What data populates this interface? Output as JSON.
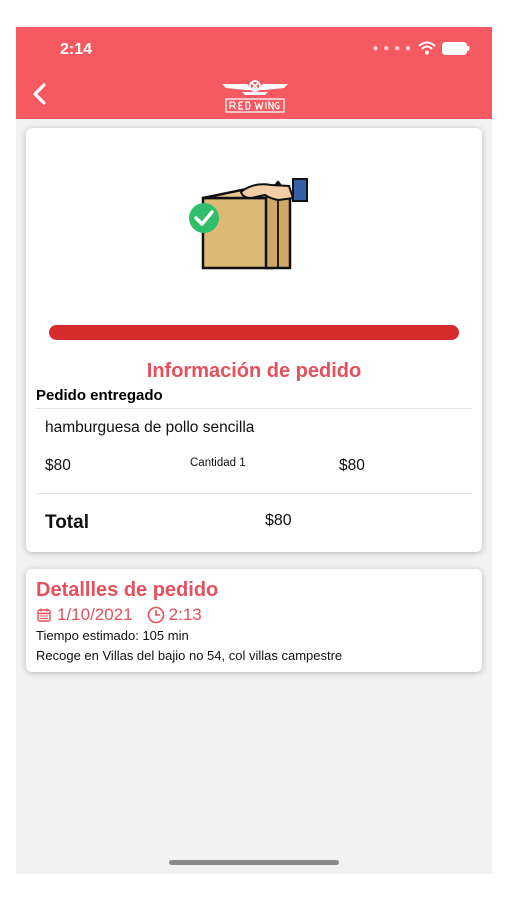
{
  "status_bar": {
    "time": "2:14"
  },
  "header": {
    "brand": "RED WINGS"
  },
  "order_info": {
    "title": "Información de pedido",
    "status": "Pedido entregado",
    "progress": 1.0,
    "item": {
      "name": "hamburguesa de pollo sencilla",
      "unit_price": "$80",
      "quantity_label": "Cantidad 1",
      "line_total": "$80"
    },
    "total_label": "Total",
    "total_value": "$80"
  },
  "order_details": {
    "title": "Detallles de pedido",
    "date": "1/10/2021",
    "time": "2:13",
    "estimated_time": "Tiempo estimado: 105 min",
    "pickup": "Recoge en Villas del bajio no 54, col villas campestre"
  },
  "colors": {
    "header": "#f55a63",
    "accent": "#e4505c",
    "progress": "#d62b2b",
    "check": "#2fbf6a",
    "bag": "#ddb976"
  }
}
